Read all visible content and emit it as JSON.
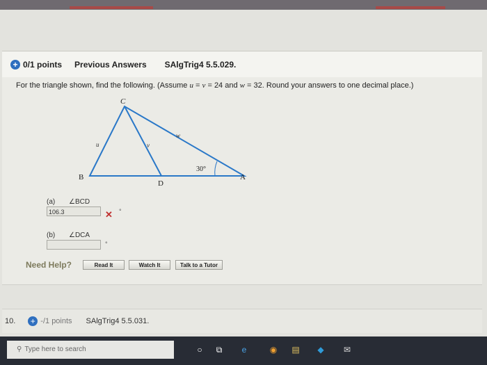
{
  "header": {
    "points": "0/1 points",
    "previous_answers": "Previous Answers",
    "question_id": "SAlgTrig4 5.5.029."
  },
  "prompt": {
    "part1": "For the triangle shown, find the following. (Assume ",
    "var_u": "u",
    "eq1": " = ",
    "var_v": "v",
    "eq2": " = 24 and ",
    "var_w": "w",
    "part2": " = 32. Round your answers to one decimal place.)"
  },
  "figure": {
    "vertex_C": "C",
    "vertex_B": "B",
    "vertex_D": "D",
    "vertex_A": "A",
    "side_u": "u",
    "side_v": "v",
    "side_w": "w",
    "angle_A": "30°"
  },
  "parts": [
    {
      "letter": "(a)",
      "angle": "∠BCD",
      "value": "106.3",
      "unit": "°",
      "status": "incorrect"
    },
    {
      "letter": "(b)",
      "angle": "∠DCA",
      "value": "",
      "unit": "°"
    }
  ],
  "help": {
    "label": "Need Help?",
    "read_it": "Read It",
    "watch_it": "Watch It",
    "talk_to_tutor": "Talk to a Tutor"
  },
  "next_question": {
    "number": "10.",
    "points": "-/1 points",
    "question_id": "SAlgTrig4 5.5.031."
  },
  "taskbar": {
    "search_placeholder": "Type here to search"
  },
  "colors": {
    "accent_blue": "#2f6fbf",
    "incorrect_red": "#c0302f",
    "triangle_blue": "#2a78c8"
  }
}
